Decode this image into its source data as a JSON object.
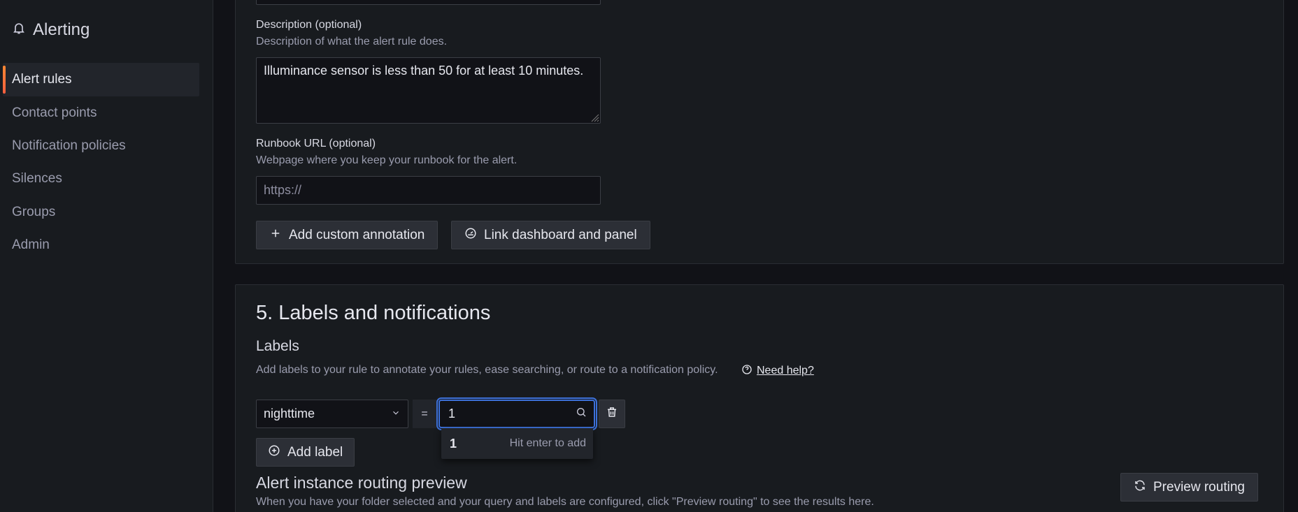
{
  "sidebar": {
    "title": "Alerting",
    "items": [
      {
        "label": "Alert rules",
        "active": true
      },
      {
        "label": "Contact points"
      },
      {
        "label": "Notification policies"
      },
      {
        "label": "Silences"
      },
      {
        "label": "Groups"
      },
      {
        "label": "Admin"
      }
    ]
  },
  "annotations": {
    "description_label": "Description (optional)",
    "description_help": "Description of what the alert rule does.",
    "description_value": "Illuminance sensor is less than 50 for at least 10 minutes.",
    "runbook_label": "Runbook URL (optional)",
    "runbook_help": "Webpage where you keep your runbook for the alert.",
    "runbook_placeholder": "https://",
    "add_annotation_button": "Add custom annotation",
    "link_dashboard_button": "Link dashboard and panel"
  },
  "labels_section": {
    "title": "5. Labels and notifications",
    "subtitle": "Labels",
    "help_text": "Add labels to your rule to annotate your rules, ease searching, or route to a notification policy.",
    "need_help": "Need help?",
    "label_key": "nighttime",
    "operator": "=",
    "label_value": "1",
    "dropdown_option": "1",
    "dropdown_hint": "Hit enter to add",
    "add_label_button": "Add label"
  },
  "routing_preview": {
    "title": "Alert instance routing preview",
    "help_text": "When you have your folder selected and your query and labels are configured, click \"Preview routing\" to see the results here.",
    "button": "Preview routing"
  },
  "colors": {
    "accent_active": "#ff8833",
    "focus_border": "#3d71d9"
  }
}
